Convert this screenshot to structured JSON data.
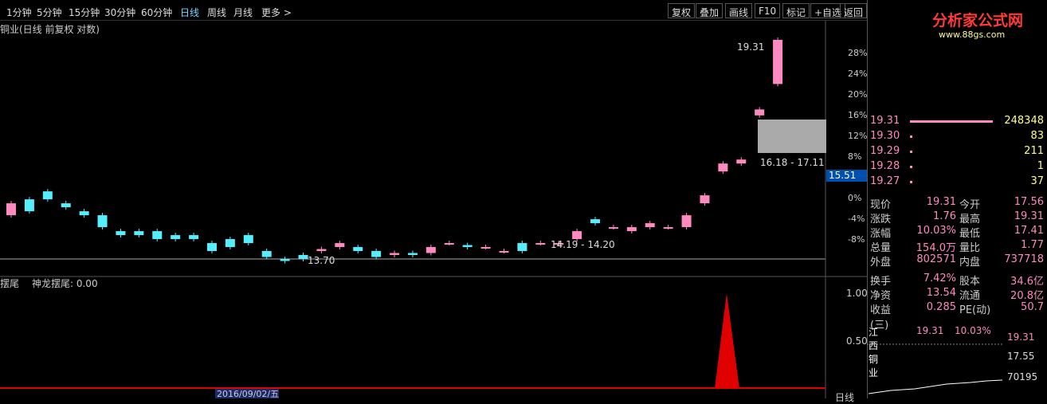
{
  "toolbar": {
    "tfs": [
      "1分钟",
      "5分钟",
      "15分钟",
      "30分钟",
      "60分钟",
      "日线",
      "周线",
      "月线",
      "更多 >"
    ],
    "btns": [
      "复权",
      "叠加",
      "画线",
      "F10",
      "标记",
      "+自选",
      "返回"
    ]
  },
  "sub": "铜业(日线 前复权 对数)",
  "price_labels": {
    "high": "19.31",
    "box": "16.18 - 17.11",
    "low": "13.70",
    "mid": "14.19 - 14.20",
    "cur": "15.51"
  },
  "pct_axis": [
    "28%",
    "24%",
    "20%",
    "16%",
    "12%",
    "8%",
    "4%",
    "0%",
    "-4%",
    "-8%"
  ],
  "indicator": {
    "title": "摆尾",
    "label": "神龙摆尾: 0.00",
    "ticks": [
      "1.00",
      "0.50"
    ]
  },
  "date": "2016/09/02/五",
  "logo": {
    "text": "分析家公式网",
    "url": "www.88gs.com"
  },
  "orderbook": [
    {
      "p": "19.31",
      "v": "248348"
    },
    {
      "p": "19.30",
      "v": "83"
    },
    {
      "p": "19.29",
      "v": "211"
    },
    {
      "p": "19.28",
      "v": "1"
    },
    {
      "p": "19.27",
      "v": "37"
    }
  ],
  "quote": [
    [
      "现价",
      "19.31",
      "今开",
      "17.56"
    ],
    [
      "涨跌",
      "1.76",
      "最高",
      "19.31"
    ],
    [
      "涨幅",
      "10.03%",
      "最低",
      "17.41"
    ],
    [
      "总量",
      "154.0万",
      "量比",
      "1.77"
    ],
    [
      "外盘",
      "802571",
      "内盘",
      "737718"
    ],
    [
      "换手",
      "7.42%",
      "股本",
      "34.6亿"
    ],
    [
      "净资",
      "13.54",
      "流通",
      "20.8亿"
    ],
    [
      "收益(三)",
      "0.285",
      "PE(动)",
      "50.7"
    ]
  ],
  "mini": {
    "name": "江西铜业",
    "price": "19.31",
    "pct": "10.03%",
    "p1": "19.31",
    "p2": "17.55",
    "vol": "70195"
  },
  "bottom_tab": "日线",
  "chart_data": {
    "type": "candlestick",
    "x_label": "2016/09/02/五",
    "y_range": [
      13.7,
      19.31
    ],
    "values": [
      [
        14.9,
        15.2
      ],
      [
        15.3,
        15.0
      ],
      [
        15.5,
        15.3
      ],
      [
        15.2,
        15.1
      ],
      [
        15.0,
        14.9
      ],
      [
        14.9,
        14.6
      ],
      [
        14.5,
        14.4
      ],
      [
        14.5,
        14.4
      ],
      [
        14.5,
        14.3
      ],
      [
        14.4,
        14.3
      ],
      [
        14.4,
        14.3
      ],
      [
        14.2,
        14.0
      ],
      [
        14.3,
        14.1
      ],
      [
        14.4,
        14.2
      ],
      [
        14.0,
        13.85
      ],
      [
        13.8,
        13.75
      ],
      [
        13.9,
        13.8
      ],
      [
        14.0,
        14.05
      ],
      [
        14.1,
        14.2
      ],
      [
        14.1,
        14.0
      ],
      [
        14.0,
        13.85
      ],
      [
        13.9,
        13.95
      ],
      [
        13.95,
        13.9
      ],
      [
        13.95,
        14.1
      ],
      [
        14.2,
        14.2
      ],
      [
        14.15,
        14.1
      ],
      [
        14.1,
        14.1
      ],
      [
        14.0,
        14.0
      ],
      [
        14.2,
        14.0
      ],
      [
        14.2,
        14.2
      ],
      [
        14.2,
        14.2
      ],
      [
        14.3,
        14.5
      ],
      [
        14.8,
        14.7
      ],
      [
        14.6,
        14.6
      ],
      [
        14.5,
        14.6
      ],
      [
        14.6,
        14.7
      ],
      [
        14.6,
        14.6
      ],
      [
        14.6,
        14.9
      ],
      [
        15.2,
        15.4
      ],
      [
        16.0,
        16.2
      ],
      [
        16.2,
        16.3
      ],
      [
        17.41,
        17.56
      ],
      [
        18.2,
        19.31
      ]
    ]
  }
}
